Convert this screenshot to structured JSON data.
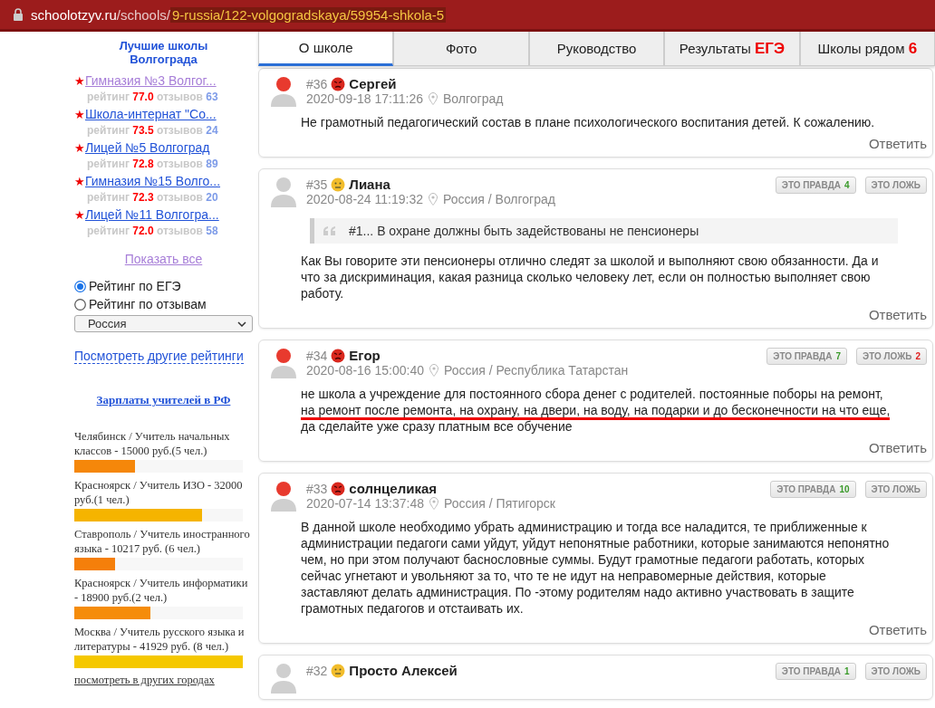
{
  "address_bar": {
    "host": "schoolotzyv.ru",
    "path": "/schools/",
    "highlighted_path": "9-russia/122-volgogradskaya/59954-shkola-5"
  },
  "sidebar": {
    "title": "Лучшие школы Волгограда",
    "schools": [
      {
        "marker": "★",
        "name": "Гимназия №3 Волгог...",
        "visited": true,
        "rating_label": "рейтинг",
        "rating": "77.0",
        "reviews_label": "отзывов",
        "reviews": "63"
      },
      {
        "marker": "★",
        "name": "Школа-интернат \"Со...",
        "visited": false,
        "rating_label": "рейтинг",
        "rating": "73.5",
        "reviews_label": "отзывов",
        "reviews": "24"
      },
      {
        "marker": "★",
        "name": "Лицей №5 Волгоград",
        "visited": false,
        "rating_label": "рейтинг",
        "rating": "72.8",
        "reviews_label": "отзывов",
        "reviews": "89"
      },
      {
        "marker": "★",
        "name": "Гимназия №15 Волго...",
        "visited": false,
        "rating_label": "рейтинг",
        "rating": "72.3",
        "reviews_label": "отзывов",
        "reviews": "20"
      },
      {
        "marker": "★",
        "name": "Лицей №11 Волгогра...",
        "visited": false,
        "rating_label": "рейтинг",
        "rating": "72.0",
        "reviews_label": "отзывов",
        "reviews": "58"
      }
    ],
    "show_all": {
      "label": "Показать все",
      "visited": true
    },
    "rating_modes": [
      {
        "label": "Рейтинг по ЕГЭ",
        "selected": true
      },
      {
        "label": "Рейтинг по отзывам",
        "selected": false
      }
    ],
    "region_select": {
      "value": "Россия"
    },
    "other_ratings_link": "Посмотреть другие рейтинги",
    "salaries_title": "Зарплаты учителей в РФ",
    "salaries": [
      {
        "text": "Челябинск / Учитель начальных классов - 15000 руб.(5 чел.)",
        "level": 0.36,
        "color": "#f5870a"
      },
      {
        "text": "Красноярск / Учитель ИЗО - 32000 руб.(1 чел.)",
        "level": 0.76,
        "color": "#f5b400"
      },
      {
        "text": "Ставрополь / Учитель иностранного языка - 10217 руб. (6 чел.)",
        "level": 0.24,
        "color": "#f57f0a"
      },
      {
        "text": "Красноярск / Учитель информатики - 18900 руб.(2 чел.)",
        "level": 0.45,
        "color": "#f58c0a"
      },
      {
        "text": "Москва / Учитель русского языка и литературы - 41929 руб. (8 чел.)",
        "level": 1.0,
        "color": "#f5c800"
      }
    ],
    "more_cities_link": "посмотреть в других городах"
  },
  "tabs": [
    {
      "label": "О школе",
      "selected": true
    },
    {
      "label": "Фото",
      "selected": false
    },
    {
      "label": "Руководство",
      "selected": false
    },
    {
      "label": "Результаты",
      "accent": "ЕГЭ",
      "selected": false
    },
    {
      "label": "Школы рядом",
      "accent": "6",
      "selected": false
    }
  ],
  "reviews": [
    {
      "number": "#36",
      "kind": "angry",
      "author": "Сергей",
      "date": "2020-09-18 17:11:26",
      "location": "Волгоград",
      "body": [
        {
          "text": "Не грамотный педагогический состав в плане психологического воспитания детей. К сожалению.",
          "underlined": false
        }
      ],
      "reply": "Ответить"
    },
    {
      "number": "#35",
      "kind": "neutral",
      "author": "Лиана",
      "date": "2020-08-24 11:19:32",
      "location": "Россия / Волгоград",
      "true_label": "ЭТО ПРАВДА",
      "true_count": "4",
      "false_label": "ЭТО ЛОЖЬ",
      "quote": "#1... В охране должны быть задействованы не пенсионеры",
      "body": [
        {
          "text": "Как Вы говорите эти пенсионеры отлично следят за школой и выполняют свою обязанности. Да и что за дискриминация, какая разница сколько человеку лет, если он полностью выполняет свою работу.",
          "underlined": false
        }
      ],
      "reply": "Ответить"
    },
    {
      "number": "#34",
      "kind": "angry",
      "author": "Егор",
      "date": "2020-08-16 15:00:40",
      "location": "Россия / Республика Татарстан",
      "true_label": "ЭТО ПРАВДА",
      "true_count": "7",
      "false_label": "ЭТО ЛОЖЬ",
      "false_count": "2",
      "body": [
        {
          "text": "не школа а учреждение для постоянного сбора денег с родителей. постоянные поборы на ремонт,",
          "underlined": false
        },
        {
          "text": "на ремонт после ремонта, на охрану, на двери, на воду, на подарки и до бесконечности на что еще,",
          "underlined": true
        },
        {
          "text": "да сделайте уже сразу платным все обучение",
          "underlined": false
        }
      ],
      "reply": "Ответить"
    },
    {
      "number": "#33",
      "kind": "angry",
      "author": "солнцеликая",
      "date": "2020-07-14 13:37:48",
      "location": "Россия / Пятигорск",
      "true_label": "ЭТО ПРАВДА",
      "true_count": "10",
      "false_label": "ЭТО ЛОЖЬ",
      "body": [
        {
          "text": "В данной школе необходимо убрать администрацию и тогда все наладится, те приближенные к администрации педагоги сами уйдут, уйдут непонятные работники, которые занимаются непонятно чем, но при этом получают баснословные суммы. Будут грамотные педагоги работать, которых сейчас угнетают и увольняют за то, что те не идут на неправомерные действия, которые заставляют делать администрация. По -этому родителям надо активно участвовать в защите грамотных педагогов и отстаивать их.",
          "underlined": false
        }
      ],
      "reply": "Ответить"
    },
    {
      "number": "#32",
      "kind": "neutral",
      "author": "Просто Алексей",
      "true_label": "ЭТО ПРАВДА",
      "true_count": "1",
      "false_label": "ЭТО ЛОЖЬ"
    }
  ]
}
